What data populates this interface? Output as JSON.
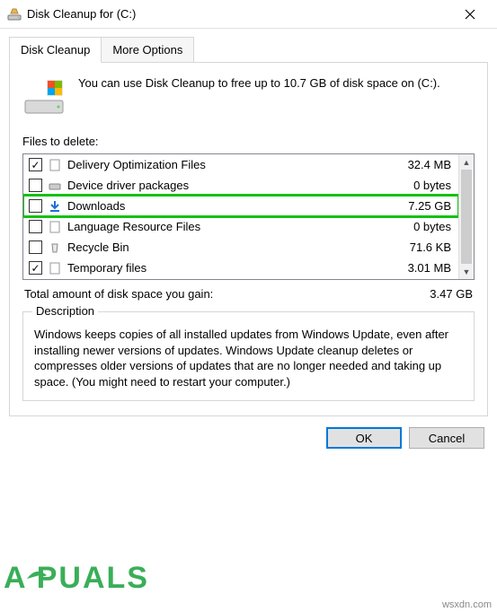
{
  "window": {
    "title": "Disk Cleanup for  (C:)"
  },
  "tabs": {
    "cleanup": "Disk Cleanup",
    "more": "More Options"
  },
  "intro": "You can use Disk Cleanup to free up to 10.7 GB of disk space on  (C:).",
  "files_label": "Files to delete:",
  "files": [
    {
      "checked": true,
      "icon": "file",
      "name": "Delivery Optimization Files",
      "size": "32.4 MB"
    },
    {
      "checked": false,
      "icon": "drive",
      "name": "Device driver packages",
      "size": "0 bytes"
    },
    {
      "checked": false,
      "icon": "download",
      "name": "Downloads",
      "size": "7.25 GB",
      "highlight": true
    },
    {
      "checked": false,
      "icon": "file",
      "name": "Language Resource Files",
      "size": "0 bytes"
    },
    {
      "checked": false,
      "icon": "recycle",
      "name": "Recycle Bin",
      "size": "71.6 KB"
    },
    {
      "checked": true,
      "icon": "file",
      "name": "Temporary files",
      "size": "3.01 MB"
    }
  ],
  "total": {
    "label": "Total amount of disk space you gain:",
    "value": "3.47 GB"
  },
  "description": {
    "legend": "Description",
    "text": "Windows keeps copies of all installed updates from Windows Update, even after installing newer versions of updates. Windows Update cleanup deletes or compresses older versions of updates that are no longer needed and taking up space. (You might need to restart your computer.)"
  },
  "buttons": {
    "ok": "OK",
    "cancel": "Cancel"
  },
  "watermark": "wsxdn.com",
  "brand": "A   PUALS"
}
